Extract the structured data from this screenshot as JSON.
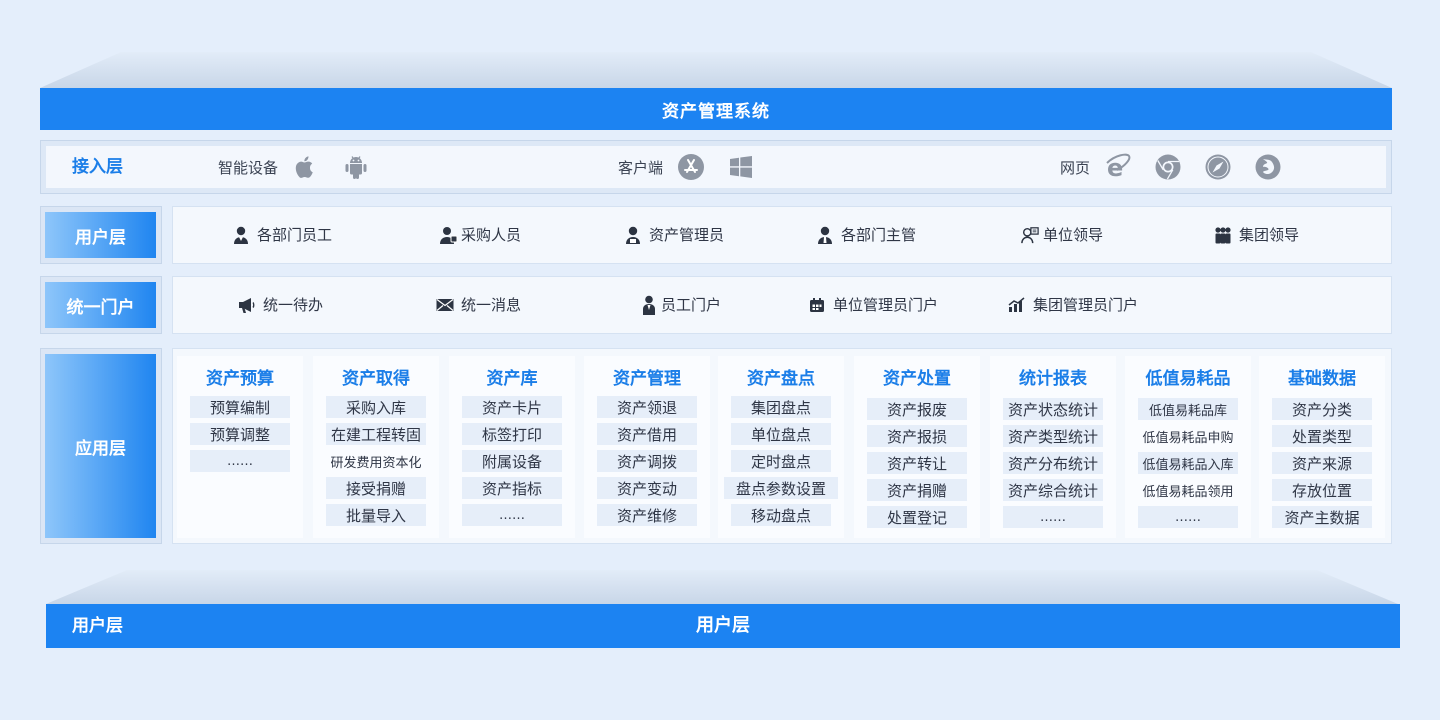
{
  "system_title": "资产管理系统",
  "access_layer": {
    "title": "接入层",
    "groups": [
      {
        "label": "智能设备",
        "icons": [
          "apple-icon",
          "android-icon"
        ]
      },
      {
        "label": "客户端",
        "icons": [
          "app-store-icon",
          "windows-icon"
        ]
      },
      {
        "label": "网页",
        "icons": [
          "ie-icon",
          "chrome-icon",
          "safari-icon",
          "firefox-icon"
        ]
      }
    ]
  },
  "user_layer": {
    "title": "用户层",
    "items": [
      {
        "label": "各部门员工",
        "icon": "employee-icon"
      },
      {
        "label": "采购人员",
        "icon": "purchaser-icon"
      },
      {
        "label": "资产管理员",
        "icon": "asset-admin-icon"
      },
      {
        "label": "各部门主管",
        "icon": "supervisor-icon"
      },
      {
        "label": "单位领导",
        "icon": "unit-leader-icon"
      },
      {
        "label": "集团领导",
        "icon": "group-leader-icon"
      }
    ]
  },
  "portal_layer": {
    "title": "统一门户",
    "items": [
      {
        "label": "统一待办",
        "icon": "megaphone-icon"
      },
      {
        "label": "统一消息",
        "icon": "mail-icon"
      },
      {
        "label": "员工门户",
        "icon": "person-icon"
      },
      {
        "label": "单位管理员门户",
        "icon": "calendar-icon"
      },
      {
        "label": "集团管理员门户",
        "icon": "chart-icon"
      }
    ]
  },
  "app_layer": {
    "title": "应用层",
    "modules": [
      {
        "title": "资产预算",
        "items": [
          "预算编制",
          "预算调整",
          "……"
        ]
      },
      {
        "title": "资产取得",
        "items": [
          "采购入库",
          "在建工程转固",
          "研发费用资本化",
          "接受捐赠",
          "批量导入"
        ]
      },
      {
        "title": "资产库",
        "items": [
          "资产卡片",
          "标签打印",
          "附属设备",
          "资产指标",
          "……"
        ]
      },
      {
        "title": "资产管理",
        "items": [
          "资产领退",
          "资产借用",
          "资产调拨",
          "资产变动",
          "资产维修"
        ]
      },
      {
        "title": "资产盘点",
        "items": [
          "集团盘点",
          "单位盘点",
          "定时盘点",
          "盘点参数设置",
          "移动盘点"
        ]
      },
      {
        "title": "资产处置",
        "items": [
          "资产报废",
          "资产报损",
          "资产转让",
          "资产捐赠",
          "处置登记"
        ]
      },
      {
        "title": "统计报表",
        "items": [
          "资产状态统计",
          "资产类型统计",
          "资产分布统计",
          "资产综合统计",
          "……"
        ]
      },
      {
        "title": "低值易耗品",
        "items": [
          "低值易耗品库",
          "低值易耗品申购",
          "低值易耗品入库",
          "低值易耗品领用",
          "……"
        ]
      },
      {
        "title": "基础数据",
        "items": [
          "资产分类",
          "处置类型",
          "资产来源",
          "存放位置",
          "资产主数据"
        ]
      }
    ]
  },
  "bottom": {
    "left_label": "用户层",
    "center_label": "用户层"
  },
  "colors": {
    "primary": "#1c83f2",
    "accent_text": "#1b7ee8",
    "background": "#e4eefb"
  }
}
